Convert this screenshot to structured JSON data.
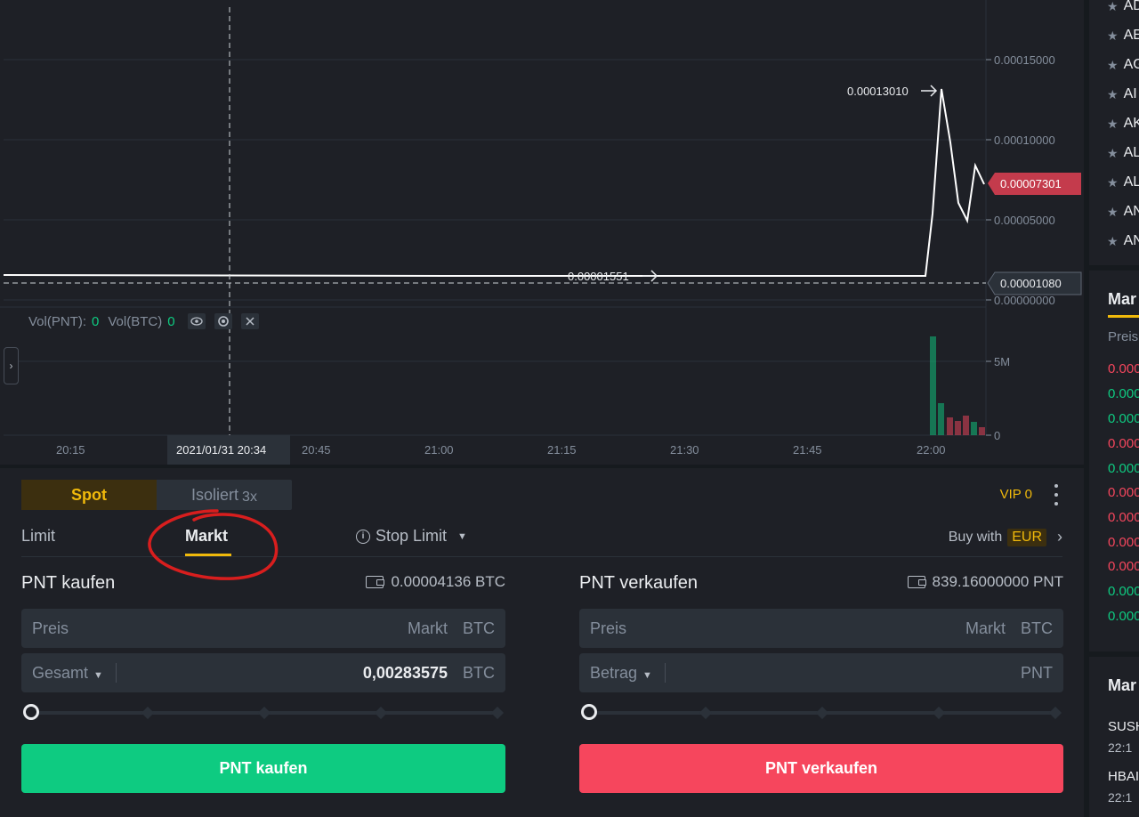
{
  "chart": {
    "price_axis_labels": [
      "0.00015000",
      "0.00010000",
      "0.00005000",
      "0.00000000"
    ],
    "volume_axis_labels": [
      "5M",
      "0"
    ],
    "time_axis_labels": [
      "20:15",
      "20:45",
      "21:00",
      "21:15",
      "21:30",
      "21:45",
      "22:00"
    ],
    "crosshair_time": "2021/01/31 20:34",
    "high_marker": "0.00013010",
    "low_marker": "0.00001551",
    "last_price_tag": "0.00007301",
    "crosshair_price_tag": "0.00001080",
    "volume_legend": {
      "pnt_label": "Vol(PNT):",
      "pnt_value": "0",
      "btc_label": "Vol(BTC)",
      "btc_value": "0"
    },
    "colors": {
      "up": "#0ecb81",
      "down": "#f6465d",
      "line": "#ffffff"
    }
  },
  "trade": {
    "mode_spot": "Spot",
    "mode_isolated": "Isoliert",
    "mode_isolated_leverage": "3x",
    "vip": "VIP 0",
    "tabs": {
      "limit": "Limit",
      "market": "Markt",
      "stop_limit": "Stop Limit"
    },
    "buy_with_label": "Buy with",
    "buy_with_currency": "EUR",
    "buy": {
      "title": "PNT kaufen",
      "balance": "0.00004136 BTC",
      "price_label": "Preis",
      "price_value": "Markt",
      "price_unit": "BTC",
      "total_label": "Gesamt",
      "total_value": "0,00283575",
      "total_unit": "BTC",
      "button": "PNT kaufen"
    },
    "sell": {
      "title": "PNT verkaufen",
      "balance": "839.16000000 PNT",
      "price_label": "Preis",
      "price_value": "Markt",
      "price_unit": "BTC",
      "amount_label": "Betrag",
      "amount_unit": "PNT",
      "button": "PNT verkaufen"
    },
    "accent": "#f0b90b"
  },
  "sidebar": {
    "pairs": [
      "AD",
      "AE",
      "AG",
      "AI",
      "AK",
      "AL",
      "AL",
      "AN",
      "AN"
    ],
    "trades_title": "Mar",
    "trades_header": "Preis",
    "trades": [
      {
        "price": "0.000",
        "dir": "down"
      },
      {
        "price": "0.000",
        "dir": "up"
      },
      {
        "price": "0.000",
        "dir": "up"
      },
      {
        "price": "0.000",
        "dir": "down"
      },
      {
        "price": "0.000",
        "dir": "up"
      },
      {
        "price": "0.000",
        "dir": "down"
      },
      {
        "price": "0.000",
        "dir": "down"
      },
      {
        "price": "0.000",
        "dir": "down"
      },
      {
        "price": "0.000",
        "dir": "down"
      },
      {
        "price": "0.000",
        "dir": "up"
      },
      {
        "price": "0.000",
        "dir": "up"
      }
    ],
    "movers_title": "Mar",
    "movers": [
      {
        "symbol": "SUSH",
        "time": "22:1"
      },
      {
        "symbol": "HBAI",
        "time": "22:1"
      }
    ]
  }
}
